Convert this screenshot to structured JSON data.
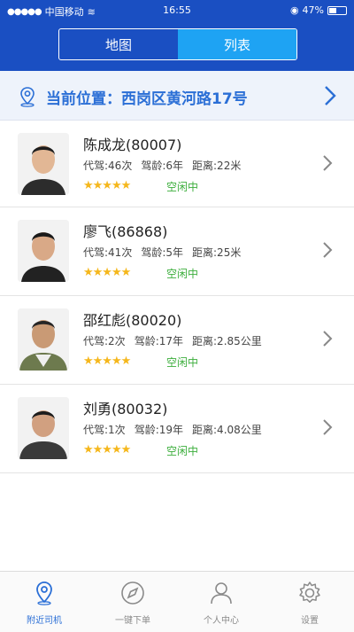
{
  "status_bar": {
    "carrier": "中国移动",
    "time": "16:55",
    "battery": "47%"
  },
  "header": {
    "tabs": [
      {
        "label": "地图",
        "active": false
      },
      {
        "label": "列表",
        "active": true
      }
    ]
  },
  "location": {
    "label": "当前位置：",
    "address": "西岗区黄河路17号"
  },
  "drivers": [
    {
      "name": "陈成龙(80007)",
      "stats": [
        "代驾:46次",
        "驾龄:6年",
        "距离:22米"
      ],
      "rating": 5,
      "status": "空闲中"
    },
    {
      "name": "廖飞(86868)",
      "stats": [
        "代驾:41次",
        "驾龄:5年",
        "距离:25米"
      ],
      "rating": 5,
      "status": "空闲中"
    },
    {
      "name": "邵红彪(80020)",
      "stats": [
        "代驾:2次",
        "驾龄:17年",
        "距离:2.85公里"
      ],
      "rating": 5,
      "status": "空闲中"
    },
    {
      "name": "刘勇(80032)",
      "stats": [
        "代驾:1次",
        "驾龄:19年",
        "距离:4.08公里"
      ],
      "rating": 5,
      "status": "空闲中"
    }
  ],
  "tabbar": [
    {
      "label": "附近司机",
      "icon": "location-pin-icon",
      "active": true
    },
    {
      "label": "一键下单",
      "icon": "compass-icon",
      "active": false
    },
    {
      "label": "个人中心",
      "icon": "person-icon",
      "active": false
    },
    {
      "label": "设置",
      "icon": "gear-icon",
      "active": false
    }
  ],
  "colors": {
    "header": "#1a4fc2",
    "active_segment": "#1ea3f3",
    "accent": "#2b6fd6",
    "star": "#f5b71c",
    "status_green": "#3cae3c"
  }
}
